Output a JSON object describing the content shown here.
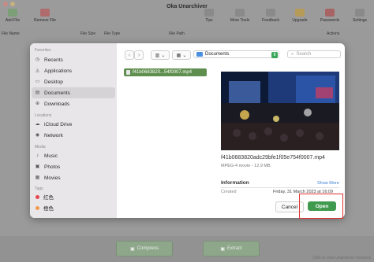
{
  "app": {
    "title": "Oka Unarchiver",
    "toolbar_left": [
      {
        "label": "Add File",
        "icon": "add-file-icon"
      },
      {
        "label": "Remove File",
        "icon": "remove-file-icon"
      }
    ],
    "toolbar_right": [
      {
        "label": "Tips",
        "icon": "lightbulb-icon"
      },
      {
        "label": "More Tools",
        "icon": "grid-icon"
      },
      {
        "label": "Feedback",
        "icon": "feedback-icon"
      },
      {
        "label": "Upgrade",
        "icon": "crown-icon"
      },
      {
        "label": "Passwords",
        "icon": "password-icon"
      },
      {
        "label": "Settings",
        "icon": "gear-icon"
      }
    ],
    "columns": {
      "file_name": "File Name",
      "file_size": "File Size",
      "file_type": "File Type",
      "file_path": "File Path",
      "actions": "Actions"
    },
    "compress_label": "Compress",
    "extract_label": "Extract",
    "footer_text": "Click to view Unarchiver Versions"
  },
  "dialog": {
    "sidebar": {
      "favorites_header": "Favorites",
      "favorites": [
        {
          "label": "Recents",
          "icon": "clock-icon"
        },
        {
          "label": "Applications",
          "icon": "applications-icon"
        },
        {
          "label": "Desktop",
          "icon": "desktop-icon"
        },
        {
          "label": "Documents",
          "icon": "document-icon",
          "selected": true
        },
        {
          "label": "Downloads",
          "icon": "download-icon"
        }
      ],
      "locations_header": "Locations",
      "locations": [
        {
          "label": "iCloud Drive",
          "icon": "cloud-icon"
        },
        {
          "label": "Network",
          "icon": "network-icon"
        }
      ],
      "media_header": "Media",
      "media": [
        {
          "label": "Music",
          "icon": "music-icon"
        },
        {
          "label": "Photos",
          "icon": "photos-icon"
        },
        {
          "label": "Movies",
          "icon": "movies-icon"
        }
      ],
      "tags_header": "Tags",
      "tags": [
        {
          "label": "红色",
          "color": "#e5484d"
        },
        {
          "label": "橙色",
          "color": "#f2994a"
        }
      ]
    },
    "location": "Documents",
    "search_placeholder": "Search",
    "selected_file": "f41b0683820...54f0007.mp4",
    "preview": {
      "file_name": "f41b0683820adc29bfe1f05e754f0007.mp4",
      "subtitle": "MPEG-4 movie - 12.9 MB",
      "information_label": "Information",
      "show_more_label": "Show More",
      "created_label": "Created",
      "created_value": "Friday, 31 March 2023 at 16:09"
    },
    "cancel_label": "Cancel",
    "open_label": "Open"
  }
}
